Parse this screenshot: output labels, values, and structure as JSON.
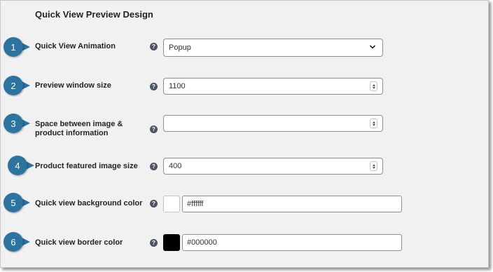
{
  "section": {
    "title": "Quick View Preview Design"
  },
  "help_glyph": "?",
  "colors": {
    "badge": "#2c73a0",
    "background_swatch": "#ffffff",
    "border_swatch": "#000000"
  },
  "rows": [
    {
      "badge": "1",
      "label": "Quick View Animation",
      "type": "select",
      "value": "Popup"
    },
    {
      "badge": "2",
      "label": "Preview window size",
      "type": "number",
      "value": "1100"
    },
    {
      "badge": "3",
      "label": "Space between image & product information",
      "type": "number",
      "value": ""
    },
    {
      "badge": "4",
      "label": "Product featured image size",
      "type": "number",
      "value": "400"
    },
    {
      "badge": "5",
      "label": "Quick view background color",
      "type": "color",
      "value": "#ffffff"
    },
    {
      "badge": "6",
      "label": "Quick view border color",
      "type": "color",
      "value": "#000000"
    }
  ]
}
